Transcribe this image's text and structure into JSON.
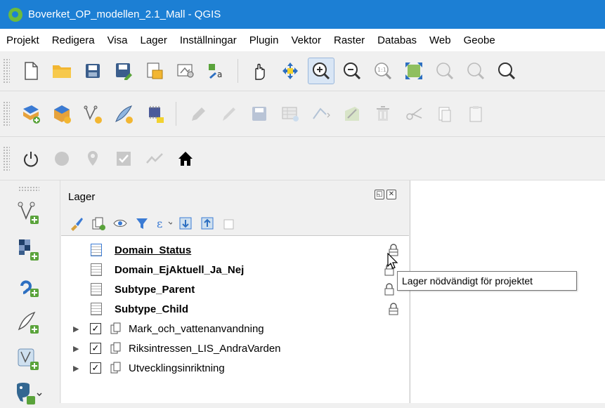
{
  "window": {
    "title": "Boverket_OP_modellen_2.1_Mall - QGIS",
    "accent_color": "#1c7fd4"
  },
  "menu": {
    "items": [
      "Projekt",
      "Redigera",
      "Visa",
      "Lager",
      "Inställningar",
      "Plugin",
      "Vektor",
      "Raster",
      "Databas",
      "Web",
      "Geobe"
    ]
  },
  "toolbars": {
    "row1_icons": [
      "new-project-icon",
      "open-project-icon",
      "save-icon",
      "save-as-icon",
      "print-layout-icon",
      "layout-manager-icon",
      "style-manager-icon",
      "pan-icon",
      "pan-to-selection-icon",
      "zoom-in-icon",
      "zoom-out-icon",
      "zoom-native-icon",
      "zoom-full-icon",
      "zoom-to-layer-icon",
      "zoom-last-icon",
      "zoom-next-icon"
    ],
    "row2_icons": [
      "add-layer-icon",
      "new-geopackage-icon",
      "new-vector-icon",
      "digitize-icon",
      "toggle-editing-icon",
      "edit-pen-icon",
      "pencil-icon",
      "save-edits-icon",
      "attribute-table-icon",
      "vertex-tool-icon",
      "edit-node-icon",
      "delete-icon",
      "cut-icon",
      "copy-icon",
      "paste-icon"
    ],
    "row3_icons": [
      "power-icon",
      "circle-icon",
      "location-pin-icon",
      "checkbox-icon",
      "trend-line-icon",
      "home-icon"
    ],
    "left_icons": [
      "add-vector-layer-icon",
      "add-raster-layer-icon",
      "add-wms-layer-icon",
      "add-delimited-text-icon",
      "add-virtual-layer-icon",
      "add-postgis-layer-icon"
    ]
  },
  "layers_panel": {
    "title": "Lager",
    "toolbar_icons": [
      "style-brush-icon",
      "add-group-icon",
      "eye-icon",
      "filter-icon",
      "expression-filter-icon",
      "expand-all-icon",
      "collapse-all-icon",
      "remove-layer-icon"
    ],
    "items": [
      {
        "name": "Domain_Status",
        "type": "table",
        "bold": true,
        "locked": true,
        "underline": true
      },
      {
        "name": "Domain_EjAktuell_Ja_Nej",
        "type": "table",
        "bold": true,
        "locked": true
      },
      {
        "name": "Subtype_Parent",
        "type": "table",
        "bold": true,
        "locked": true
      },
      {
        "name": "Subtype_Child",
        "type": "table",
        "bold": true,
        "locked": true
      },
      {
        "name": "Mark_och_vattenanvandning",
        "type": "group",
        "checked": true
      },
      {
        "name": "Riksintressen_LIS_AndraVarden",
        "type": "group",
        "checked": true
      },
      {
        "name": "Utvecklingsinriktning",
        "type": "group",
        "checked": true
      }
    ]
  },
  "tooltip": {
    "text": "Lager nödvändigt för projektet"
  }
}
